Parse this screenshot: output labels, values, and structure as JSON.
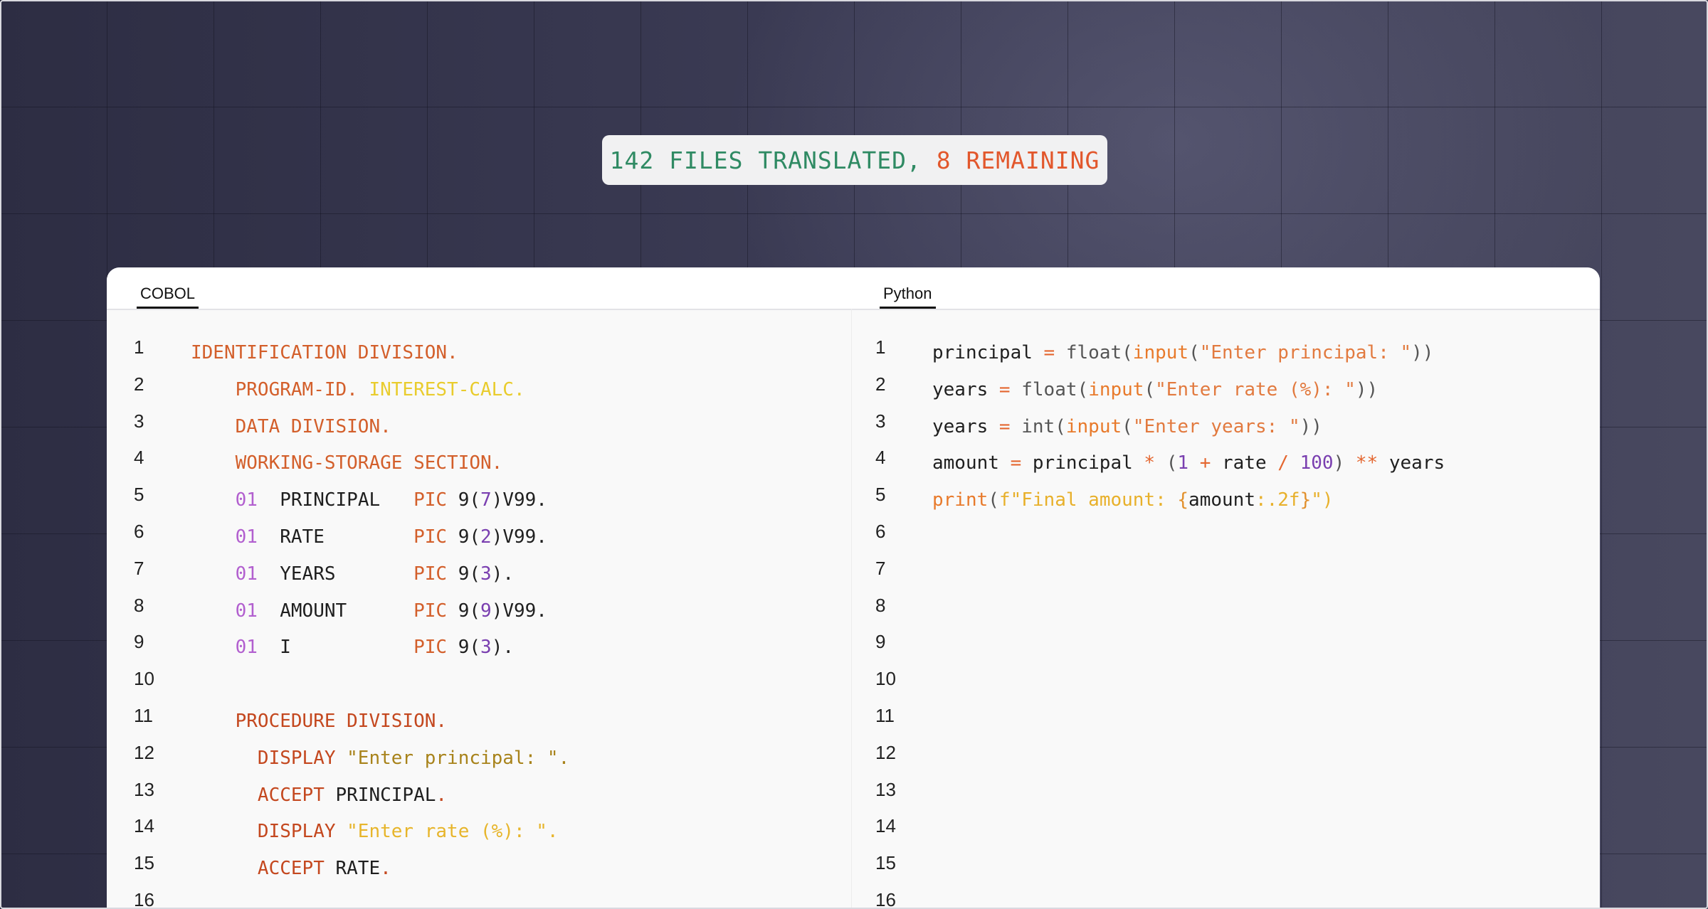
{
  "status": {
    "translated_text": "142 FILES TRANSLATED, ",
    "remaining_text": "8 REMAINING",
    "colors": {
      "translated": "#2f8a63",
      "remaining": "#e2572c"
    }
  },
  "tabs": {
    "left": "COBOL",
    "right": "Python"
  },
  "line_numbers": [
    "1",
    "2",
    "3",
    "4",
    "5",
    "6",
    "7",
    "8",
    "9",
    "10",
    "11",
    "12",
    "13",
    "14",
    "15",
    "16"
  ],
  "cobol_lines": [
    [
      {
        "t": "IDENTIFICATION DIVISION.",
        "c": "kw"
      }
    ],
    [
      {
        "t": "    ",
        "c": "id"
      },
      {
        "t": "PROGRAM-ID. ",
        "c": "kw"
      },
      {
        "t": "INTEREST-CALC.",
        "c": "yl"
      }
    ],
    [
      {
        "t": "    ",
        "c": "id"
      },
      {
        "t": "DATA DIVISION.",
        "c": "kw"
      }
    ],
    [
      {
        "t": "    ",
        "c": "id"
      },
      {
        "t": "WORKING-STORAGE SECTION.",
        "c": "kw"
      }
    ],
    [
      {
        "t": "    ",
        "c": "id"
      },
      {
        "t": "01",
        "c": "pu"
      },
      {
        "t": "  PRINCIPAL   ",
        "c": "id"
      },
      {
        "t": "PIC ",
        "c": "kw"
      },
      {
        "t": "9(",
        "c": "id"
      },
      {
        "t": "7",
        "c": "nm"
      },
      {
        "t": ")V99.",
        "c": "id"
      }
    ],
    [
      {
        "t": "    ",
        "c": "id"
      },
      {
        "t": "01",
        "c": "pu"
      },
      {
        "t": "  RATE        ",
        "c": "id"
      },
      {
        "t": "PIC ",
        "c": "kw"
      },
      {
        "t": "9(",
        "c": "id"
      },
      {
        "t": "2",
        "c": "nm"
      },
      {
        "t": ")V99.",
        "c": "id"
      }
    ],
    [
      {
        "t": "    ",
        "c": "id"
      },
      {
        "t": "01",
        "c": "pu"
      },
      {
        "t": "  YEARS       ",
        "c": "id"
      },
      {
        "t": "PIC ",
        "c": "kw"
      },
      {
        "t": "9(",
        "c": "id"
      },
      {
        "t": "3",
        "c": "nm"
      },
      {
        "t": ").",
        "c": "id"
      }
    ],
    [
      {
        "t": "    ",
        "c": "id"
      },
      {
        "t": "01",
        "c": "pu"
      },
      {
        "t": "  AMOUNT      ",
        "c": "id"
      },
      {
        "t": "PIC ",
        "c": "kw"
      },
      {
        "t": "9(",
        "c": "id"
      },
      {
        "t": "9",
        "c": "nm"
      },
      {
        "t": ")V99.",
        "c": "id"
      }
    ],
    [
      {
        "t": "    ",
        "c": "id"
      },
      {
        "t": "01",
        "c": "pu"
      },
      {
        "t": "  I           ",
        "c": "id"
      },
      {
        "t": "PIC ",
        "c": "kw"
      },
      {
        "t": "9(",
        "c": "id"
      },
      {
        "t": "3",
        "c": "nm"
      },
      {
        "t": ").",
        "c": "id"
      }
    ],
    [],
    [
      {
        "t": "    ",
        "c": "id"
      },
      {
        "t": "PROCEDURE DIVISION.",
        "c": "kw2"
      }
    ],
    [
      {
        "t": "      ",
        "c": "id"
      },
      {
        "t": "DISPLAY ",
        "c": "kw2"
      },
      {
        "t": "\"Enter principal: \".",
        "c": "st1"
      }
    ],
    [
      {
        "t": "      ",
        "c": "id"
      },
      {
        "t": "ACCEPT ",
        "c": "kw2"
      },
      {
        "t": "PRINCIPAL",
        "c": "id"
      },
      {
        "t": ".",
        "c": "kw2"
      }
    ],
    [
      {
        "t": "      ",
        "c": "id"
      },
      {
        "t": "DISPLAY ",
        "c": "kw2"
      },
      {
        "t": "\"Enter rate (%): \".",
        "c": "st2"
      }
    ],
    [
      {
        "t": "      ",
        "c": "id"
      },
      {
        "t": "ACCEPT ",
        "c": "kw2"
      },
      {
        "t": "RATE",
        "c": "id"
      },
      {
        "t": ".",
        "c": "kw2"
      }
    ]
  ],
  "python_lines": [
    [
      {
        "t": "principal",
        "c": "id"
      },
      {
        "t": " = ",
        "c": "op"
      },
      {
        "t": "float",
        "c": "fn"
      },
      {
        "t": "(",
        "c": "fn"
      },
      {
        "t": "input",
        "c": "pr"
      },
      {
        "t": "(",
        "c": "fn"
      },
      {
        "t": "\"Enter principal: \"",
        "c": "s"
      },
      {
        "t": "))",
        "c": "fn"
      }
    ],
    [
      {
        "t": "years",
        "c": "id"
      },
      {
        "t": " = ",
        "c": "op"
      },
      {
        "t": "float",
        "c": "fn"
      },
      {
        "t": "(",
        "c": "fn"
      },
      {
        "t": "input",
        "c": "pr"
      },
      {
        "t": "(",
        "c": "fn"
      },
      {
        "t": "\"Enter rate (%): \"",
        "c": "s"
      },
      {
        "t": "))",
        "c": "fn"
      }
    ],
    [
      {
        "t": "years",
        "c": "id"
      },
      {
        "t": " = ",
        "c": "op"
      },
      {
        "t": "int",
        "c": "fn"
      },
      {
        "t": "(",
        "c": "fn"
      },
      {
        "t": "input",
        "c": "pr"
      },
      {
        "t": "(",
        "c": "fn"
      },
      {
        "t": "\"Enter years: \"",
        "c": "s"
      },
      {
        "t": "))",
        "c": "fn"
      }
    ],
    [
      {
        "t": "amount",
        "c": "id"
      },
      {
        "t": " = ",
        "c": "op"
      },
      {
        "t": "principal",
        "c": "id"
      },
      {
        "t": " * ",
        "c": "op"
      },
      {
        "t": "(",
        "c": "fn"
      },
      {
        "t": "1",
        "c": "nm"
      },
      {
        "t": " + ",
        "c": "op"
      },
      {
        "t": "rate",
        "c": "id"
      },
      {
        "t": " / ",
        "c": "op"
      },
      {
        "t": "100",
        "c": "nm"
      },
      {
        "t": ")",
        "c": "fn"
      },
      {
        "t": " ** ",
        "c": "op"
      },
      {
        "t": "years",
        "c": "id"
      }
    ],
    [
      {
        "t": "print",
        "c": "pr"
      },
      {
        "t": "(",
        "c": "fn"
      },
      {
        "t": "f\"Final amount: ",
        "c": "fs"
      },
      {
        "t": "{",
        "c": "br"
      },
      {
        "t": "amount",
        "c": "id"
      },
      {
        "t": ":.2f",
        "c": "fs"
      },
      {
        "t": "}",
        "c": "br"
      },
      {
        "t": "\")",
        "c": "fs"
      }
    ]
  ]
}
